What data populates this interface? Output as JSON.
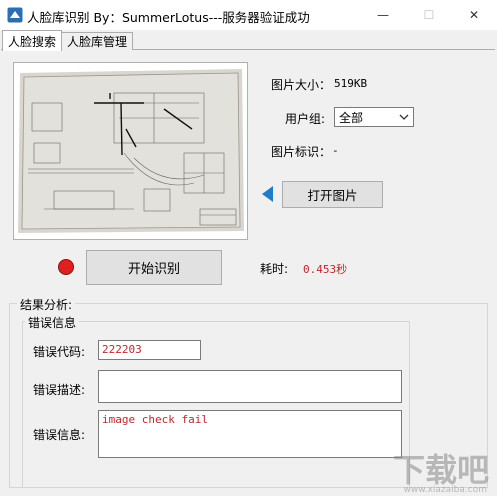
{
  "window": {
    "title": "人脸库识别 By：SummerLotus---服务器验证成功",
    "minimize_glyph": "—",
    "maximize_glyph": "☐",
    "close_glyph": "✕"
  },
  "tabs": [
    {
      "label": "人脸搜索",
      "active": true
    },
    {
      "label": "人脸库管理",
      "active": false
    }
  ],
  "image_info": {
    "size_label": "图片大小：",
    "size_value": "519KB",
    "group_label": "用户组:",
    "group_selected": "全部",
    "id_label": "图片标识：",
    "id_value": "-"
  },
  "buttons": {
    "open_image": "打开图片",
    "start_recognition": "开始识别"
  },
  "timing": {
    "label": "耗时:",
    "value": "0.453秒"
  },
  "result": {
    "group_title": "结果分析:",
    "error_group_title": "错误信息",
    "error_code_label": "错误代码:",
    "error_code_value": "222203",
    "error_desc_label": "错误描述:",
    "error_desc_value": "",
    "error_info_label": "错误信息:",
    "error_info_value": "image check fail"
  },
  "watermark": {
    "text": "下载吧",
    "sub": "www.xiazaiba.com"
  },
  "colors": {
    "accent": "#1e7cc9",
    "status_dot": "#e02020",
    "error_text": "#c0262d",
    "timing_value": "#c0262d"
  }
}
